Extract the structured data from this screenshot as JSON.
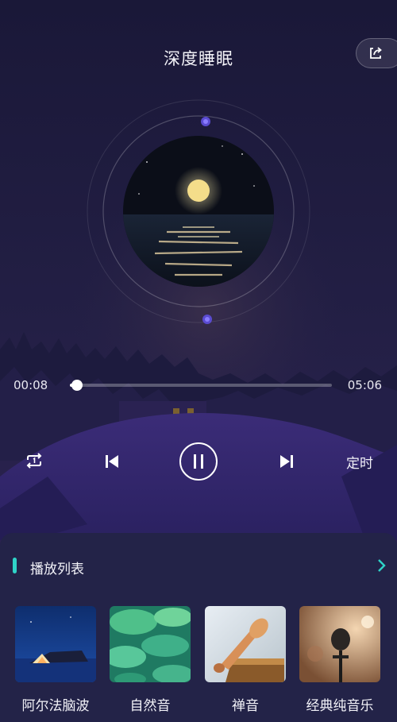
{
  "header": {
    "title": "深度睡眠"
  },
  "player": {
    "current_time": "00:08",
    "total_time": "05:06",
    "progress": 0.026,
    "timer_label": "定时",
    "state": "playing"
  },
  "playlist": {
    "title": "播放列表",
    "items": [
      {
        "label": "阿尔法脑波"
      },
      {
        "label": "自然音"
      },
      {
        "label": "禅音"
      },
      {
        "label": "经典纯音乐"
      }
    ]
  },
  "icons": {
    "share": "share-icon",
    "repeat": "repeat-icon",
    "previous": "previous-icon",
    "pause": "pause-icon",
    "next": "next-icon",
    "more": "chevron-right-icon"
  },
  "colors": {
    "accent": "#2fd3c8",
    "background": "#1b1940",
    "panel": "#232348"
  }
}
